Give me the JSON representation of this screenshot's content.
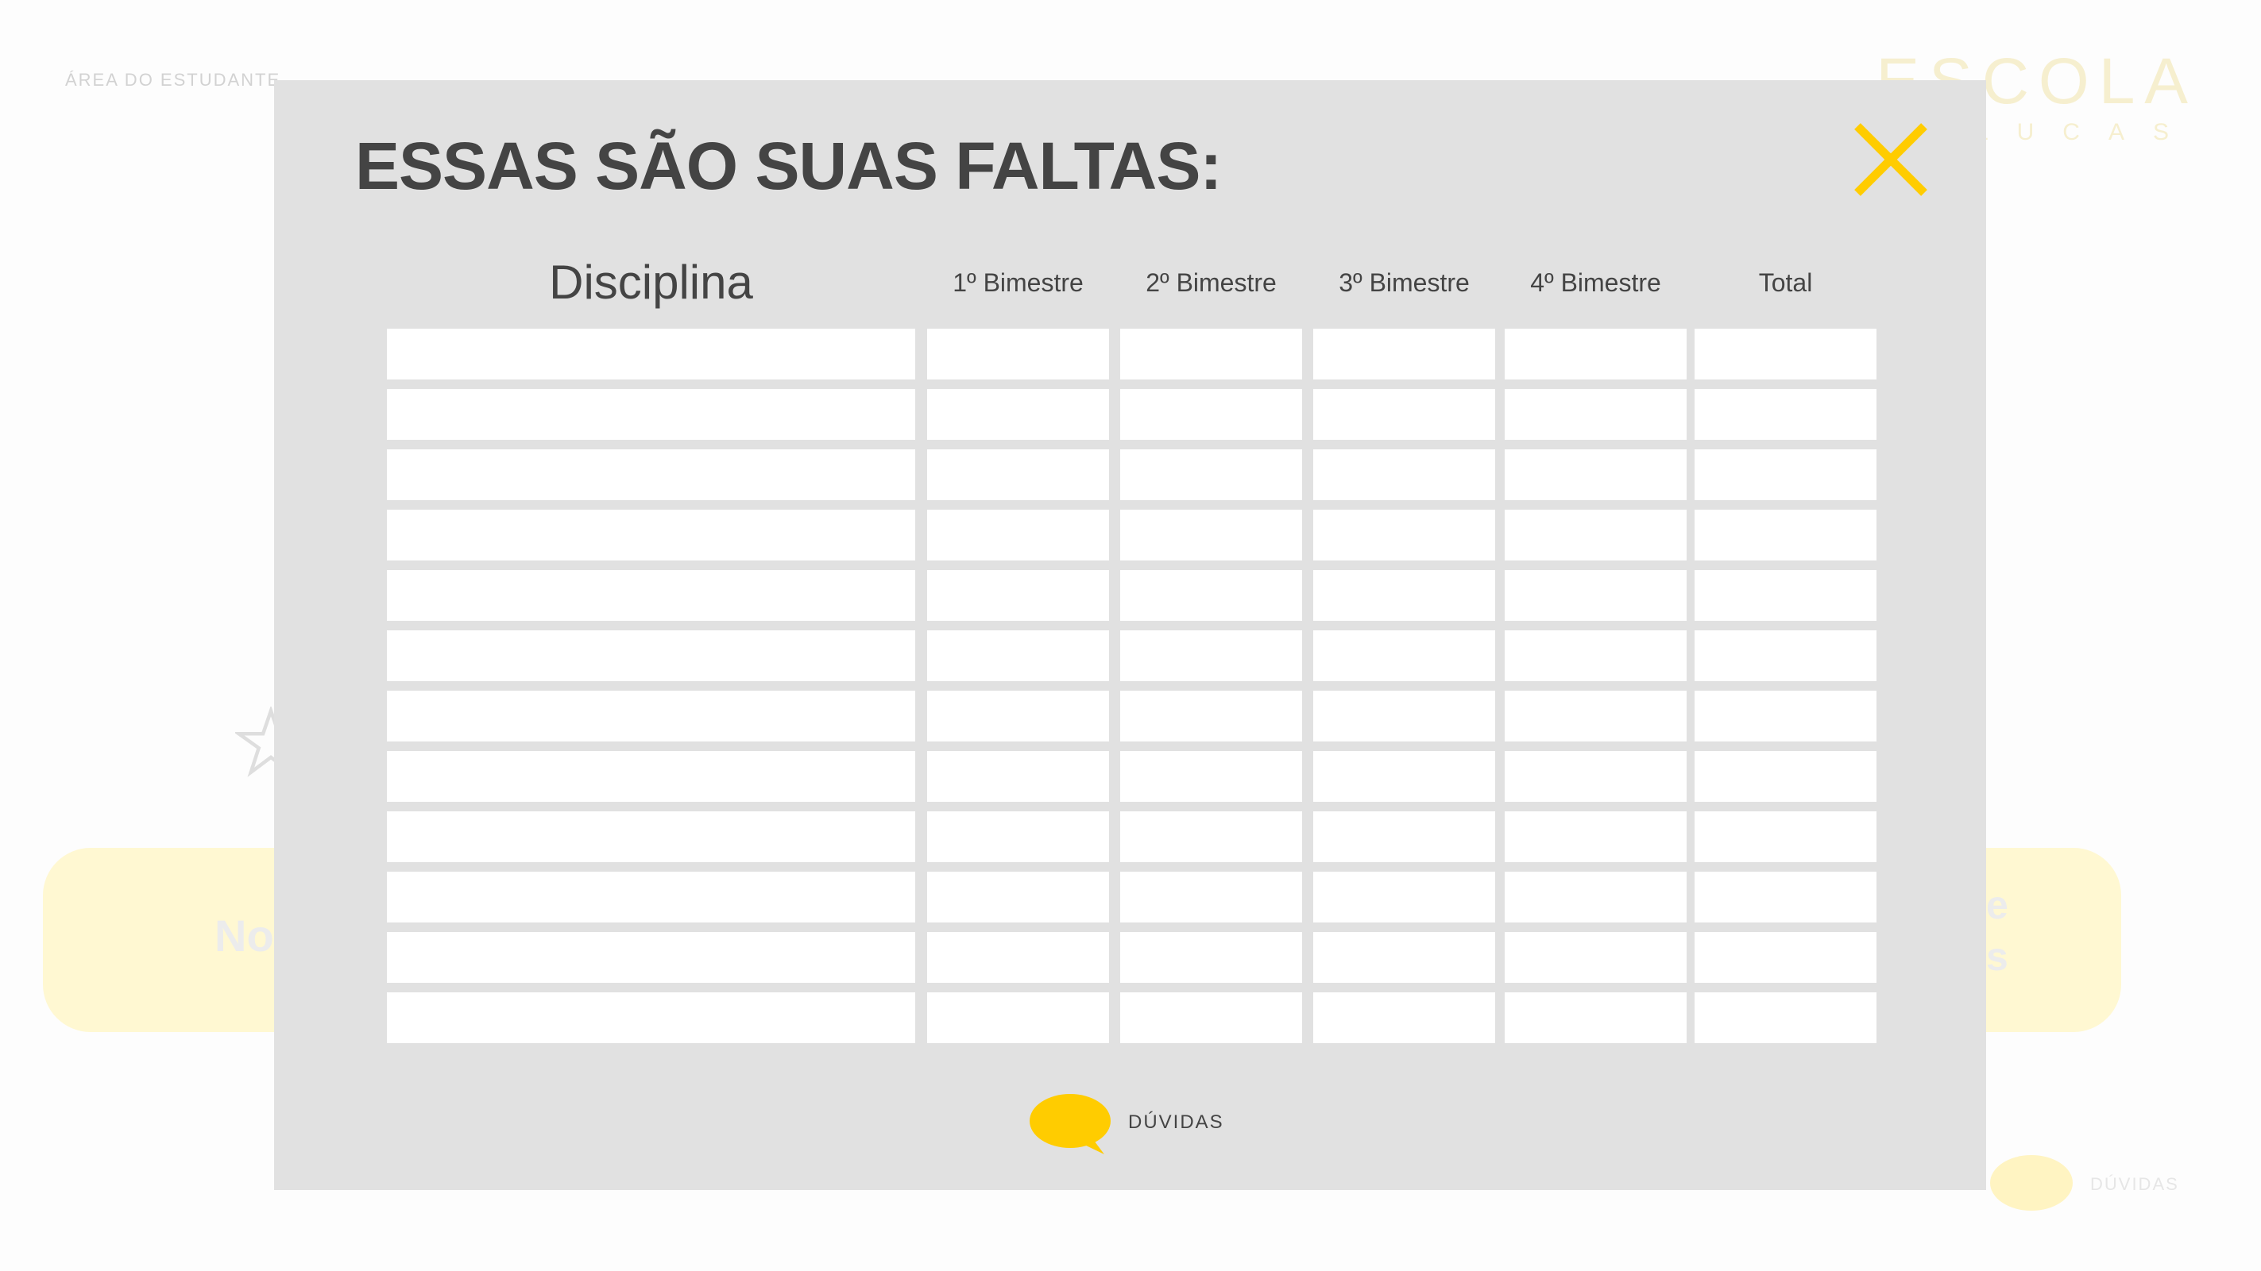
{
  "background": {
    "area_label": "ÁREA DO ESTUDANTE",
    "logo_title": "ESCOLA",
    "logo_subtitle": "SÃO LUCAS",
    "card_left_text": "No",
    "card_right_text": "e\ns",
    "help_label": "DÚVIDAS"
  },
  "modal": {
    "title": "ESSAS SÃO SUAS FALTAS:",
    "close_icon": "close-icon",
    "accent_color": "#ffcc00",
    "columns": [
      "Disciplina",
      "1º Bimestre",
      "2º Bimestre",
      "3º Bimestre",
      "4º Bimestre",
      "Total"
    ],
    "rows": [
      [
        "",
        "",
        "",
        "",
        "",
        ""
      ],
      [
        "",
        "",
        "",
        "",
        "",
        ""
      ],
      [
        "",
        "",
        "",
        "",
        "",
        ""
      ],
      [
        "",
        "",
        "",
        "",
        "",
        ""
      ],
      [
        "",
        "",
        "",
        "",
        "",
        ""
      ],
      [
        "",
        "",
        "",
        "",
        "",
        ""
      ],
      [
        "",
        "",
        "",
        "",
        "",
        ""
      ],
      [
        "",
        "",
        "",
        "",
        "",
        ""
      ],
      [
        "",
        "",
        "",
        "",
        "",
        ""
      ],
      [
        "",
        "",
        "",
        "",
        "",
        ""
      ],
      [
        "",
        "",
        "",
        "",
        "",
        ""
      ],
      [
        "",
        "",
        "",
        "",
        "",
        ""
      ]
    ],
    "help_label": "DÚVIDAS",
    "help_icon": "speech-bubble-icon"
  }
}
